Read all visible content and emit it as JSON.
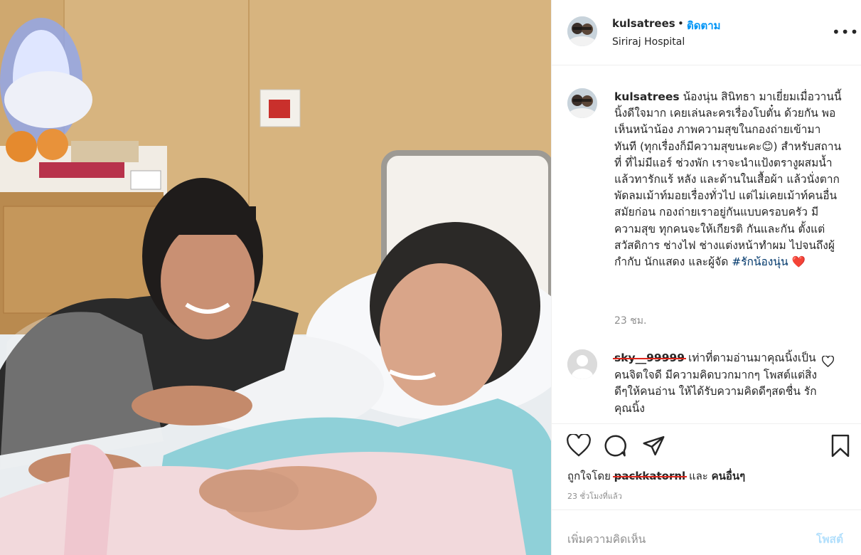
{
  "post": {
    "username": "kulsatrees",
    "dot": "•",
    "follow_label": "ติดตาม",
    "location": "Siriraj Hospital",
    "more_icon": "more-horizontal-icon"
  },
  "caption": {
    "username": "kulsatrees",
    "text": " น้องนุ่น สินิทธา มาเยี่ยมเมื่อวานนี้ นิ้งดีใจมาก เคยเล่นละครเรื่องโบตั๋น ด้วยกัน พอเห็นหน้าน้อง ภาพความสุขในกองถ่ายเข้ามาทันที (ทุกเรื่องก็มีความสุขนะคะ",
    "smiley": "😊",
    "text2": ") สำหรับสถานที่ ที่ไม่มีแอร์ ช่วงพัก เราจะนำแป้งตรางูผสมน้ำแล้วทารักแร้ หลัง และด้านในเสื้อผ้า แล้วนั่งตากพัดลมเม้าท์มอยเรื่องทั่วไป แต่ไม่เคยเม้าท์คนอื่น สมัยก่อน กองถ่ายเราอยู่กันแบบครอบครัว มีความสุข ทุกคนจะให้เกียรติ กันและกัน ตั้งแต่สวัสดิการ ช่างไฟ ช่างแต่งหน้าทำผม ไปจนถึงผู้กำกับ นักแสดง และผู้จัด ",
    "hashtag": "#รักน้องนุ่น",
    "heart": "❤️",
    "time": "23 ชม."
  },
  "comment": {
    "username": "sky__99999",
    "text": " เท่าที่ตามอ่านมาคุณนิ้งเป็นคนจิตใจดี มีความคิดบวกมากๆ โพสต์แต่สิ่งดีๆให้คนอ่าน ให้ได้รับความคิดดีๆสดชื่น รักคุณนิ้ง"
  },
  "actions": {
    "liked_prefix": "ถูกใจโดย ",
    "liked_user": "packkatornl",
    "liked_and": " และ ",
    "liked_others": "คนอื่นๆ",
    "time": "23 ชั่วโมงที่แล้ว"
  },
  "add_comment": {
    "placeholder": "เพิ่มความคิดเห็น",
    "post_label": "โพสต์"
  },
  "colors": {
    "accent": "#0095f6",
    "strike": "#e0261c"
  }
}
